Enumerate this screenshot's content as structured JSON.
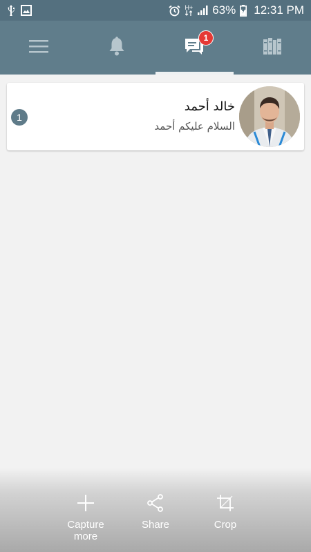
{
  "status_bar": {
    "battery": "63%",
    "time": "12:31 PM",
    "network": "H+",
    "icons": [
      "usb-icon",
      "image-icon",
      "alarm-icon",
      "signal-icon",
      "battery-icon"
    ]
  },
  "toolbar": {
    "tabs": [
      {
        "icon": "menu-icon"
      },
      {
        "icon": "bell-icon"
      },
      {
        "icon": "chat-icon",
        "badge": "1",
        "active": true
      },
      {
        "icon": "books-icon"
      }
    ]
  },
  "chats": [
    {
      "name": "خالد أحمد",
      "last_message": "السلام عليكم أحمد",
      "unread": "1"
    }
  ],
  "capture": {
    "more": "Capture\nmore",
    "share": "Share",
    "crop": "Crop"
  },
  "colors": {
    "toolbar": "#607d8b",
    "status_bar": "#54707f",
    "badge": "#e53935",
    "unread": "#5f7b89"
  }
}
